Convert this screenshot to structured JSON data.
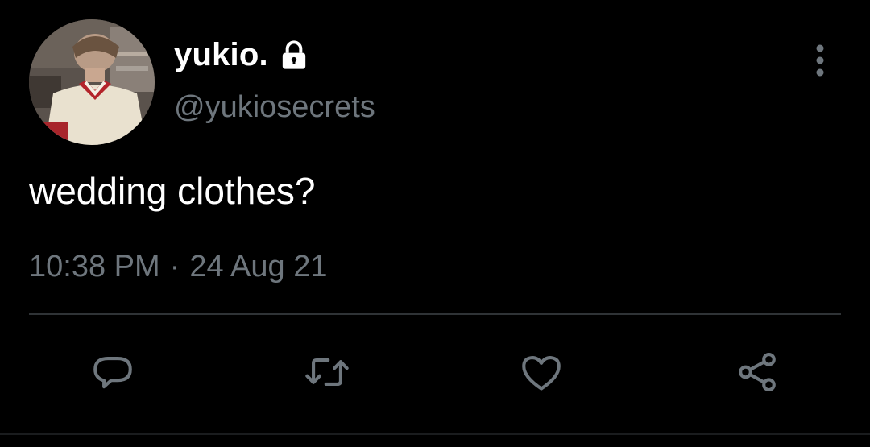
{
  "author": {
    "display_name": "yukio.",
    "handle": "@yukiosecrets",
    "protected_icon": "lock-icon"
  },
  "tweet": {
    "text": "wedding clothes?",
    "time": "10:38 PM",
    "separator": "·",
    "date": "24 Aug 21"
  },
  "actions": [
    {
      "icon": "reply-icon"
    },
    {
      "icon": "retweet-icon"
    },
    {
      "icon": "like-icon"
    },
    {
      "icon": "share-icon"
    }
  ],
  "menu": {
    "icon": "more-vertical-icon"
  },
  "colors": {
    "background": "#000000",
    "primary_text": "#ffffff",
    "secondary_text": "#6e767d",
    "divider": "#2f3336"
  }
}
